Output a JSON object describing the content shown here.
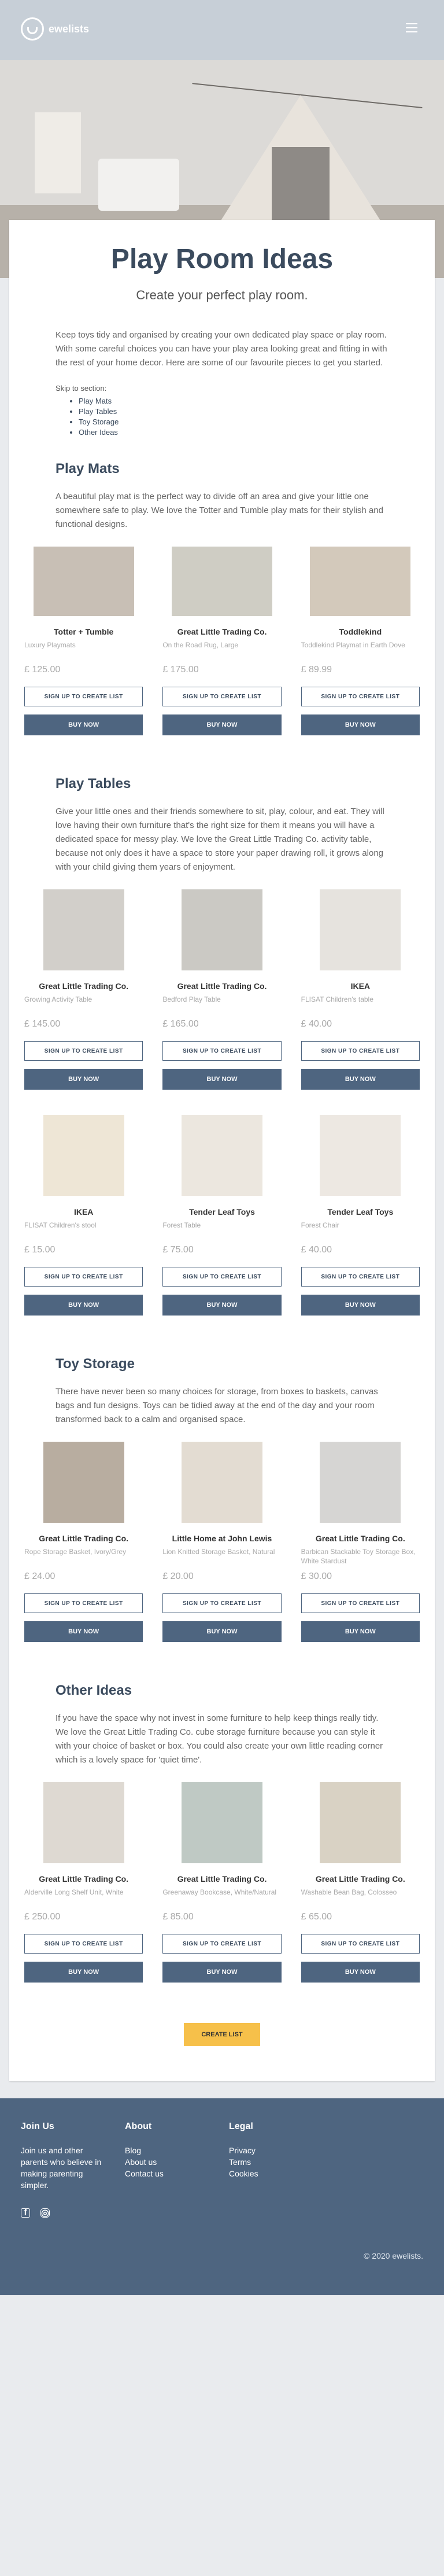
{
  "brand": {
    "name": "ewelists"
  },
  "page": {
    "title": "Play Room Ideas",
    "subtitle": "Create your perfect play room.",
    "intro": "Keep toys tidy and organised by creating your own dedicated play space or play room. With some careful choices you can have your play area looking great and fitting in with the rest of your home decor. Here are some of our favourite pieces to get you started.",
    "skip_label": "Skip to section:",
    "skip_links": [
      "Play Mats",
      "Play Tables",
      "Toy Storage",
      "Other Ideas"
    ]
  },
  "buttons": {
    "sign_up": "SIGN UP TO CREATE LIST",
    "buy_now": "BUY NOW",
    "create_list": "CREATE LIST"
  },
  "sections": [
    {
      "title": "Play Mats",
      "description": "A beautiful play mat is the perfect way to divide off an area and give your little one somewhere safe to play. We love the Totter and Tumble play mats for their stylish and functional designs.",
      "products": [
        {
          "brand": "Totter + Tumble",
          "name": "Luxury Playmats",
          "price": "£ 125.00",
          "img_color": "#c8bfb5"
        },
        {
          "brand": "Great Little Trading Co.",
          "name": "On the Road Rug, Large",
          "price": "£ 175.00",
          "img_color": "#cfcdc4"
        },
        {
          "brand": "Toddlekind",
          "name": "Toddlekind Playmat in Earth Dove",
          "price": "£ 89.99",
          "img_color": "#d3c9bb"
        }
      ]
    },
    {
      "title": "Play Tables",
      "description": "Give your little ones and their friends somewhere to sit, play, colour, and eat. They will love having their own furniture that's the right size for them it means you will have a dedicated space for messy play. We love the Great Little Trading Co. activity table, because not only does it have a space to store your paper drawing roll, it grows along with your child giving them years of enjoyment.",
      "products": [
        {
          "brand": "Great Little Trading Co.",
          "name": "Growing Activity Table",
          "price": "£ 145.00",
          "img_color": "#d2cfca"
        },
        {
          "brand": "Great Little Trading Co.",
          "name": "Bedford Play Table",
          "price": "£ 165.00",
          "img_color": "#cbc9c4"
        },
        {
          "brand": "IKEA",
          "name": "FLISAT Children's table",
          "price": "£ 40.00",
          "img_color": "#e6e3de"
        },
        {
          "brand": "IKEA",
          "name": "FLISAT Children's stool",
          "price": "£ 15.00",
          "img_color": "#eee6d6"
        },
        {
          "brand": "Tender Leaf Toys",
          "name": "Forest Table",
          "price": "£ 75.00",
          "img_color": "#ece7df"
        },
        {
          "brand": "Tender Leaf Toys",
          "name": "Forest Chair",
          "price": "£ 40.00",
          "img_color": "#ede8e2"
        }
      ]
    },
    {
      "title": "Toy Storage",
      "description": "There have never been so many choices for storage, from boxes to baskets, canvas bags and fun designs. Toys can be tidied away at the end of the day and your room transformed back to a calm and organised space.",
      "products": [
        {
          "brand": "Great Little Trading Co.",
          "name": "Rope Storage Basket, Ivory/Grey",
          "price": "£ 24.00",
          "img_color": "#b8ada0"
        },
        {
          "brand": "Little Home at John Lewis",
          "name": "Lion Knitted Storage Basket, Natural",
          "price": "£ 20.00",
          "img_color": "#e3dcd2"
        },
        {
          "brand": "Great Little Trading Co.",
          "name": "Barbican Stackable Toy Storage Box, White Stardust",
          "price": "£ 30.00",
          "img_color": "#d6d5d3"
        }
      ]
    },
    {
      "title": "Other Ideas",
      "description": "If you have the space why not invest in some furniture to help keep things really tidy. We love the Great Little Trading Co. cube storage furniture because you can style it with your choice of basket or box. You could also create your own little reading corner which is a lovely space for 'quiet time'.",
      "products": [
        {
          "brand": "Great Little Trading Co.",
          "name": "Alderville Long Shelf Unit, White",
          "price": "£ 250.00",
          "img_color": "#ded9d2"
        },
        {
          "brand": "Great Little Trading Co.",
          "name": "Greenaway Bookcase, White/Natural",
          "price": "£ 85.00",
          "img_color": "#bfc9c4"
        },
        {
          "brand": "Great Little Trading Co.",
          "name": "Washable Bean Bag, Colosseo",
          "price": "£ 65.00",
          "img_color": "#d9d2c4"
        }
      ]
    }
  ],
  "footer": {
    "join_title": "Join Us",
    "join_text": "Join us and other parents who believe in making parenting simpler.",
    "about_title": "About",
    "about_links": [
      "Blog",
      "About us",
      "Contact us"
    ],
    "legal_title": "Legal",
    "legal_links": [
      "Privacy",
      "Terms",
      "Cookies"
    ],
    "copyright": "© 2020 ewelists."
  },
  "colors": {
    "primary": "#4e6580",
    "accent": "#f6c04a",
    "title": "#3b4b5e"
  }
}
